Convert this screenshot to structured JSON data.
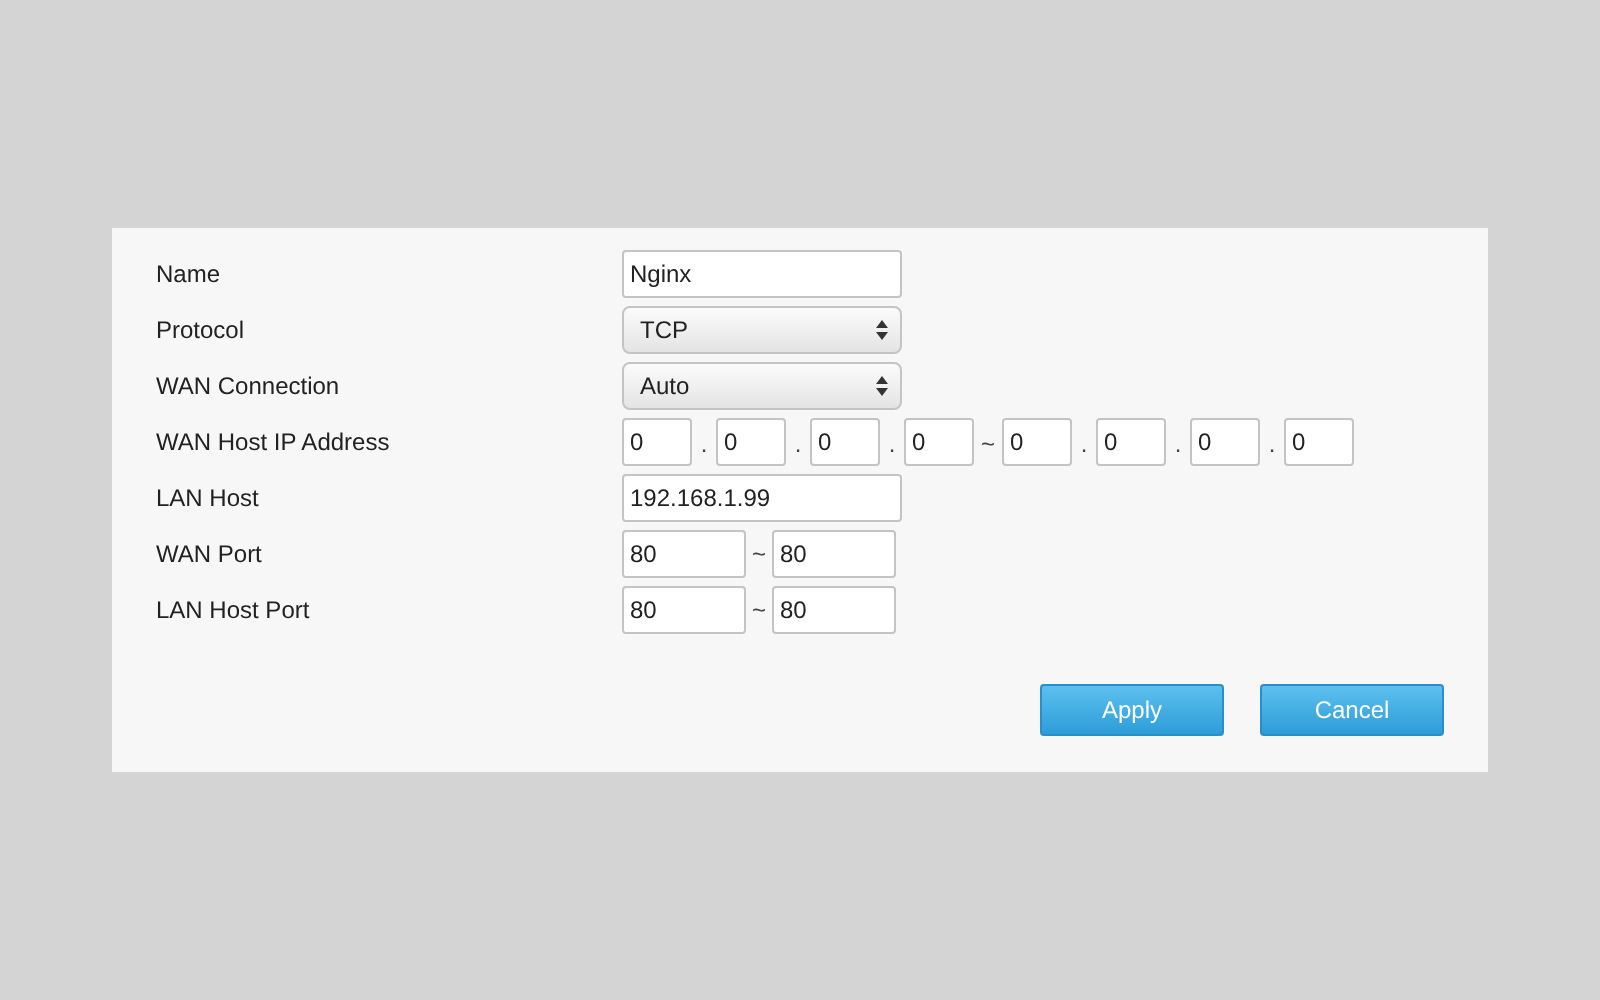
{
  "form": {
    "rows": [
      {
        "label": "Name",
        "kind": "text",
        "value": "Nginx"
      },
      {
        "label": "Protocol",
        "kind": "select",
        "value": "TCP"
      },
      {
        "label": "WAN Connection",
        "kind": "select",
        "value": "Auto"
      },
      {
        "label": "WAN Host IP Address",
        "kind": "ip_range",
        "parts": [
          {
            "kind": "field",
            "value": "0"
          },
          {
            "kind": "sep",
            "text": "."
          },
          {
            "kind": "field",
            "value": "0"
          },
          {
            "kind": "sep",
            "text": "."
          },
          {
            "kind": "field",
            "value": "0"
          },
          {
            "kind": "sep",
            "text": "."
          },
          {
            "kind": "field",
            "value": "0"
          },
          {
            "kind": "sep",
            "text": "~"
          },
          {
            "kind": "field",
            "value": "0"
          },
          {
            "kind": "sep",
            "text": "."
          },
          {
            "kind": "field",
            "value": "0"
          },
          {
            "kind": "sep",
            "text": "."
          },
          {
            "kind": "field",
            "value": "0"
          },
          {
            "kind": "sep",
            "text": "."
          },
          {
            "kind": "field",
            "value": "0"
          }
        ]
      },
      {
        "label": "LAN Host",
        "kind": "text",
        "value": "192.168.1.99"
      },
      {
        "label": "WAN Port",
        "kind": "port_range",
        "parts": [
          {
            "kind": "field",
            "value": "80"
          },
          {
            "kind": "sep",
            "text": "~"
          },
          {
            "kind": "field",
            "value": "80"
          }
        ]
      },
      {
        "label": "LAN Host Port",
        "kind": "port_range",
        "parts": [
          {
            "kind": "field",
            "value": "80"
          },
          {
            "kind": "sep",
            "text": "~"
          },
          {
            "kind": "field",
            "value": "80"
          }
        ]
      }
    ]
  },
  "buttons": [
    "Apply",
    "Cancel"
  ]
}
